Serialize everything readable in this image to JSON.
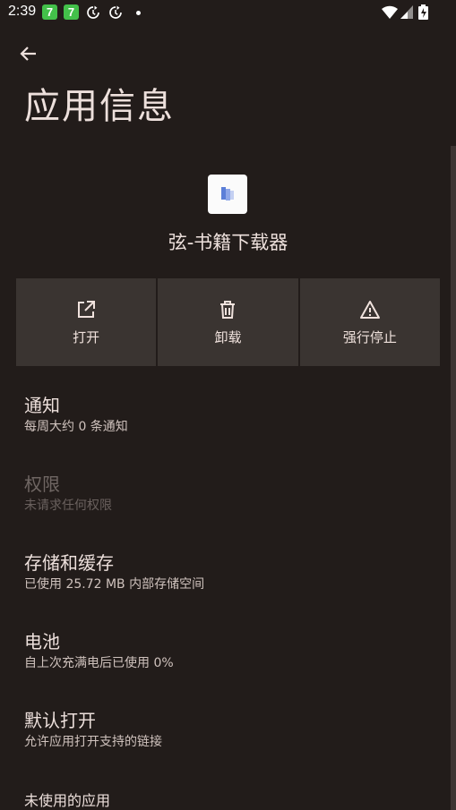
{
  "status_bar": {
    "time": "2:39",
    "badges": [
      "7",
      "7"
    ]
  },
  "page": {
    "title": "应用信息"
  },
  "app": {
    "name": "弦-书籍下载器"
  },
  "actions": [
    {
      "label": "打开",
      "icon": "open-external-icon"
    },
    {
      "label": "卸载",
      "icon": "trash-icon"
    },
    {
      "label": "强行停止",
      "icon": "warning-icon"
    }
  ],
  "settings": [
    {
      "title": "通知",
      "subtitle": "每周大约 0 条通知",
      "enabled": true
    },
    {
      "title": "权限",
      "subtitle": "未请求任何权限",
      "enabled": false
    },
    {
      "title": "存储和缓存",
      "subtitle": "已使用 25.72 MB 内部存储空间",
      "enabled": true
    },
    {
      "title": "电池",
      "subtitle": "自上次充满电后已使用 0%",
      "enabled": true
    },
    {
      "title": "默认打开",
      "subtitle": "允许应用打开支持的链接",
      "enabled": true
    },
    {
      "title": "未使用的应用",
      "subtitle": "",
      "enabled": true
    }
  ],
  "colors": {
    "background": "#221c1a",
    "action_bg": "#3a3431",
    "badge_green": "#43c04a"
  }
}
